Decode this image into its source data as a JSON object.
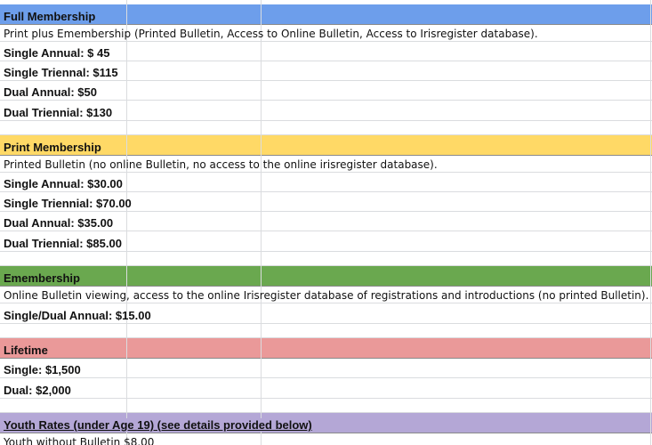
{
  "sheet": {
    "colors": {
      "blue": "#6d9eeb",
      "yellow": "#ffd966",
      "green": "#6aa84f",
      "red": "#ea9999",
      "purple": "#b4a7d6",
      "grid": "#dadcdf"
    },
    "rows": {
      "full_header": "Full Membership",
      "full_desc": "Print plus Emembership (Printed Bulletin, Access to Online Bulletin, Access to Irisregister database).",
      "full_single_annual": "Single Annual: $ 45",
      "full_single_triennial": "Single Triennal: $115",
      "full_dual_annual": "Dual Annual: $50",
      "full_dual_triennial": "Dual Triennial: $130",
      "print_header": "Print Membership",
      "print_desc": "Printed Bulletin (no online Bulletin, no access to the online irisregister database).",
      "print_single_annual": "Single Annual: $30.00",
      "print_single_triennial": "Single Triennial: $70.00",
      "print_dual_annual": "Dual Annual: $35.00",
      "print_dual_triennial": "Dual Triennial: $85.00",
      "emem_header": "Emembership",
      "emem_desc": "Online Bulletin viewing, access to the online Irisregister database of registrations and introductions (no printed Bulletin).",
      "emem_single_dual": "Single/Dual Annual: $15.00",
      "life_header": "Lifetime",
      "life_single": "Single: $1,500",
      "life_dual": "Dual: $2,000",
      "youth_header": "Youth Rates (under Age 19) (see details provided below)",
      "youth_no_bulletin": "Youth without Bulletin $8.00"
    }
  }
}
